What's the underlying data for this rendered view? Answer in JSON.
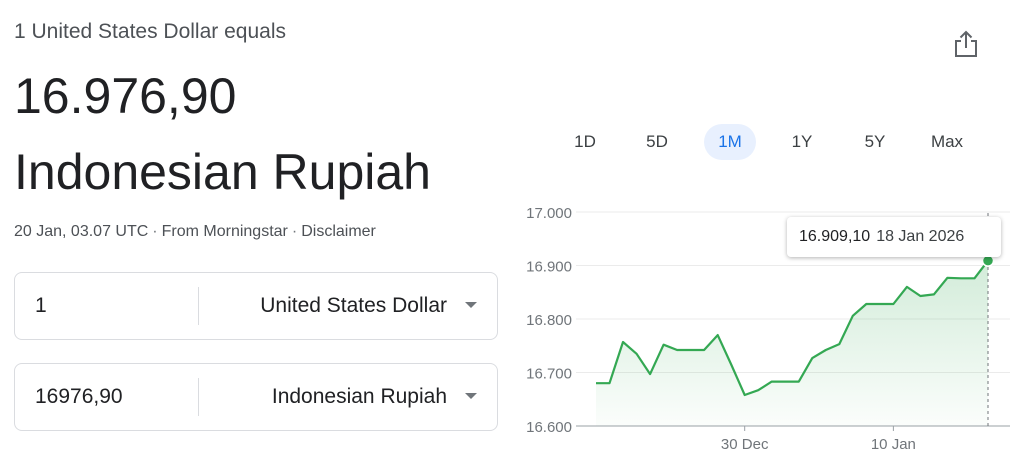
{
  "header": {
    "equals_text": "1 United States Dollar equals",
    "rate_value": "16.976,90",
    "rate_currency": "Indonesian Rupiah",
    "timestamp": "20 Jan, 03.07 UTC",
    "separator": "·",
    "source": "From Morningstar",
    "disclaimer": "Disclaimer"
  },
  "share": {
    "icon": "share-icon"
  },
  "converter": {
    "from": {
      "amount": "1",
      "currency": "United States Dollar"
    },
    "to": {
      "amount": "16976,90",
      "currency": "Indonesian Rupiah"
    }
  },
  "range_tabs": {
    "items": [
      "1D",
      "5D",
      "1M",
      "1Y",
      "5Y",
      "Max"
    ],
    "active": "1M"
  },
  "tooltip": {
    "value": "16.909,10",
    "date": "18 Jan 2026"
  },
  "colors": {
    "line": "#34a853",
    "active_tab_bg": "#e8f0fe",
    "active_tab_text": "#1a73e8"
  },
  "chart_data": {
    "type": "area",
    "ylim": [
      16600,
      17000
    ],
    "yticks": [
      "17.000",
      "16.900",
      "16.800",
      "16.700",
      "16.600"
    ],
    "ytick_values": [
      17000,
      16900,
      16800,
      16700,
      16600
    ],
    "xtick_labels": [
      "30 Dec",
      "10 Jan"
    ],
    "xtick_positions": [
      11,
      22
    ],
    "values": [
      16680,
      16680,
      16757,
      16735,
      16697,
      16752,
      16742,
      16742,
      16742,
      16770,
      16715,
      16658,
      16667,
      16683,
      16683,
      16683,
      16727,
      16742,
      16753,
      16806,
      16828,
      16828,
      16828,
      16860,
      16843,
      16846,
      16877,
      16876,
      16876,
      16909
    ],
    "highlight_index": 29
  }
}
